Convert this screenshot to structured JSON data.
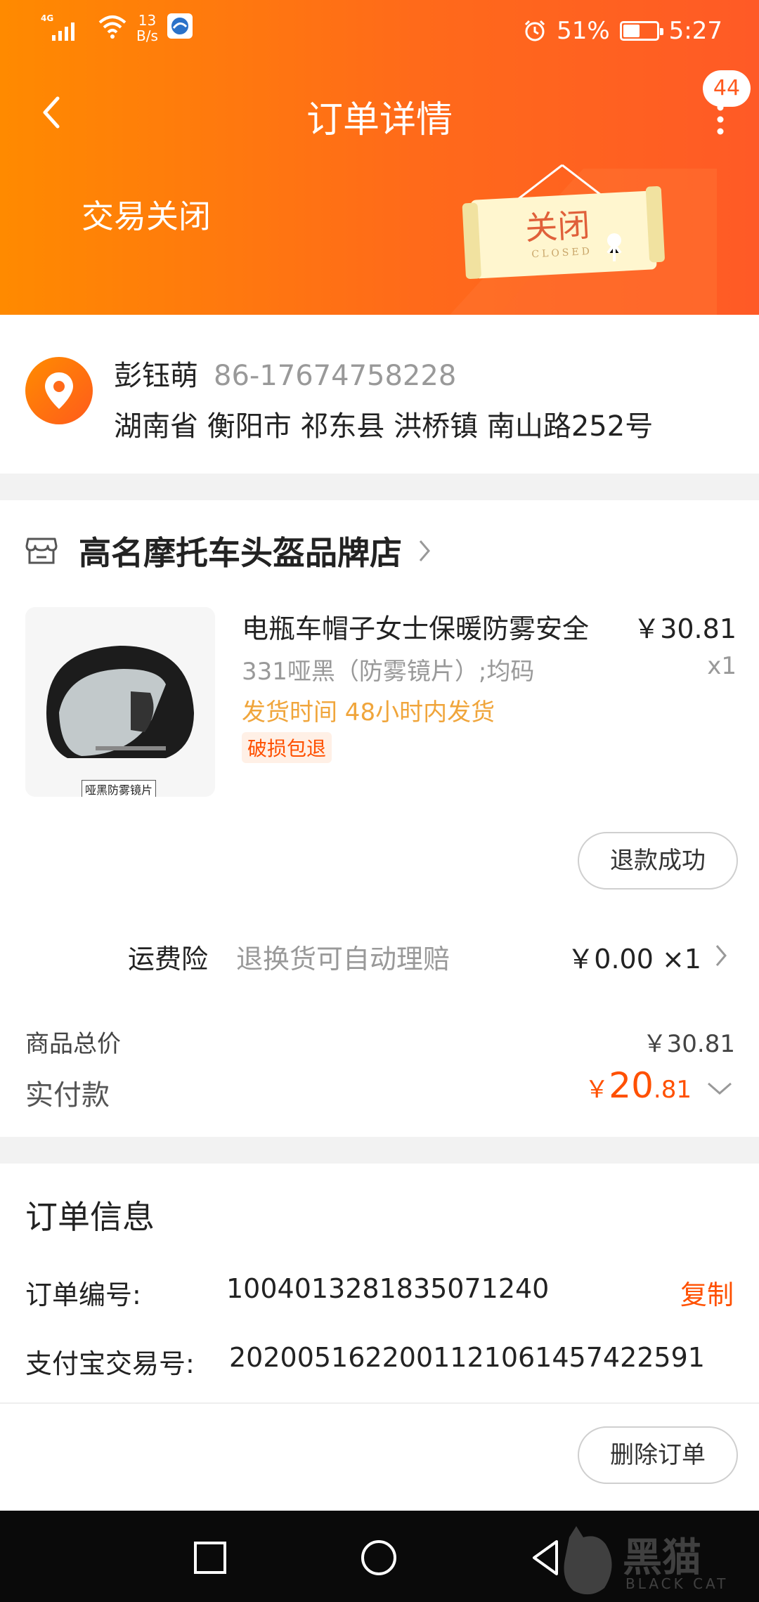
{
  "status_bar": {
    "network": "4G",
    "net_speed_value": "13",
    "net_speed_unit": "B/s",
    "battery": "51%",
    "battery_level": 0.51,
    "time": "5:27"
  },
  "nav": {
    "title": "订单详情",
    "badge_count": "44"
  },
  "status_banner": {
    "text": "交易关闭",
    "sign_text": "关闭",
    "sign_subtext": "CLOSED"
  },
  "address": {
    "name": "彭钰萌",
    "phone": "86-17674758228",
    "detail": "湖南省 衡阳市 祁东县 洪桥镇 南山路252号"
  },
  "shop": {
    "name": "高名摩托车头盔品牌店"
  },
  "product": {
    "title": "电瓶车帽子女士保暖防雾安全",
    "price": "￥30.81",
    "sku": "331哑黑（防雾镜片）;均码",
    "quantity": "x1",
    "ship_time": "发货时间 48小时内发货",
    "tag": "破损包退",
    "image_caption": "哑黑防雾镜片",
    "refund_status": "退款成功"
  },
  "insurance": {
    "label": "运费险",
    "desc": "退换货可自动理赔",
    "price": "￥0.00 ×1"
  },
  "summary": {
    "total_label": "商品总价",
    "total_value": "￥30.81",
    "paid_label": "实付款",
    "paid_symbol": "￥",
    "paid_integer": "20",
    "paid_decimal": ".81"
  },
  "order_info": {
    "title": "订单信息",
    "order_no_label": "订单编号:",
    "order_no": "1004013281835071240",
    "copy": "复制",
    "alipay_label": "支付宝交易号:",
    "alipay_no": "2020051622001121061457422591",
    "delete": "删除订单"
  },
  "watermark": {
    "text": "黑猫",
    "sub": "BLACK CAT"
  },
  "colors": {
    "accent": "#ff5000",
    "header_start": "#ff8a00",
    "header_end": "#ff5a26",
    "ship_time": "#f0a53b"
  },
  "icons": [
    "back-icon",
    "more-icon",
    "location-icon",
    "store-icon",
    "chevron-right-icon",
    "chevron-down-icon",
    "home-square-icon",
    "home-circle-icon",
    "back-triangle-icon"
  ]
}
